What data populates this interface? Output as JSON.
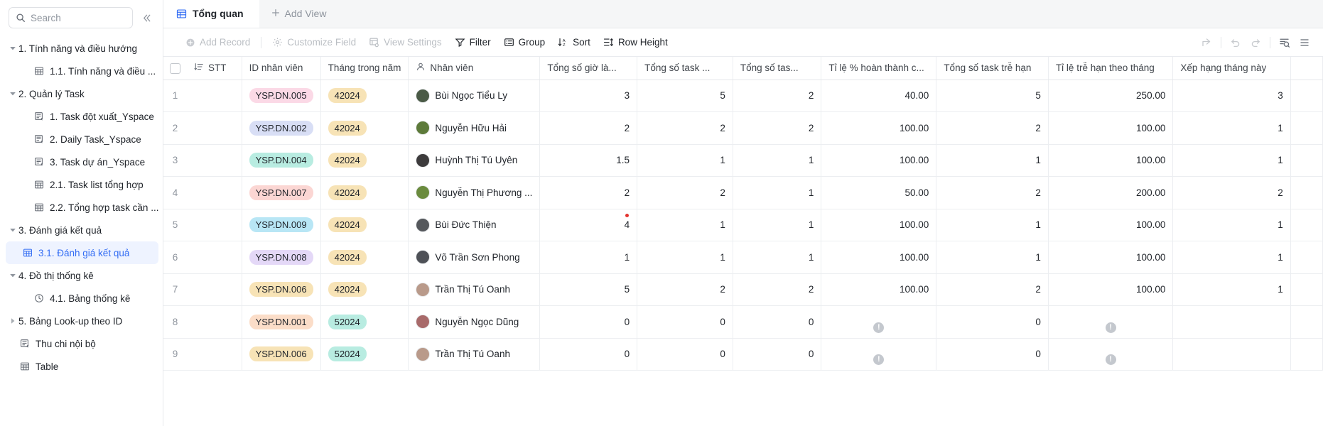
{
  "search": {
    "placeholder": "Search",
    "icon": "search-icon"
  },
  "sidebar": {
    "collapse_icon": "collapse-panel-icon",
    "items": [
      {
        "label": "1. Tính năng và điều hướng",
        "level": 0,
        "expanded": true,
        "icon": null,
        "active": false
      },
      {
        "label": "1.1. Tính năng và điều ...",
        "level": 1,
        "expanded": null,
        "icon": "table-icon",
        "active": false
      },
      {
        "label": "2. Quản lý Task",
        "level": 0,
        "expanded": true,
        "icon": null,
        "active": false
      },
      {
        "label": "1. Task đột xuất_Yspace",
        "level": 1,
        "expanded": null,
        "icon": "form-icon",
        "active": false
      },
      {
        "label": "2. Daily Task_Yspace",
        "level": 1,
        "expanded": null,
        "icon": "form-icon",
        "active": false
      },
      {
        "label": "3. Task dự án_Yspace",
        "level": 1,
        "expanded": null,
        "icon": "form-icon",
        "active": false
      },
      {
        "label": "2.1. Task list tổng hợp",
        "level": 1,
        "expanded": null,
        "icon": "table-icon",
        "active": false
      },
      {
        "label": "2.2. Tổng hợp task cần ...",
        "level": 1,
        "expanded": null,
        "icon": "table-icon",
        "active": false
      },
      {
        "label": "3. Đánh giá kết quả",
        "level": 0,
        "expanded": true,
        "icon": null,
        "active": false
      },
      {
        "label": "3.1. Đánh giá kết quả",
        "level": 1,
        "expanded": null,
        "icon": "table-icon",
        "active": true
      },
      {
        "label": "4. Đồ thị thống kê",
        "level": 0,
        "expanded": true,
        "icon": null,
        "active": false
      },
      {
        "label": "4.1. Bảng thống kê",
        "level": 1,
        "expanded": null,
        "icon": "dashboard-icon",
        "active": false
      },
      {
        "label": "5. Bảng Look-up theo ID",
        "level": 0,
        "expanded": false,
        "icon": null,
        "active": false
      },
      {
        "label": "Thu chi nội bộ",
        "level": 0,
        "expanded": null,
        "icon": "form-icon",
        "active": false
      },
      {
        "label": "Table",
        "level": 0,
        "expanded": null,
        "icon": "table-icon",
        "active": false
      }
    ]
  },
  "tabs": {
    "active": {
      "label": "Tổng quan",
      "icon": "table-icon"
    },
    "add_view": {
      "label": "Add View",
      "icon": "plus-icon"
    }
  },
  "toolbar": {
    "add_record": "Add Record",
    "customize_field": "Customize Field",
    "view_settings": "View Settings",
    "filter": "Filter",
    "group": "Group",
    "sort": "Sort",
    "row_height": "Row Height",
    "right_icons": [
      "share-icon",
      "undo-icon",
      "redo-icon",
      "search-rows-icon",
      "more-icon"
    ]
  },
  "table": {
    "columns": [
      {
        "key": "stt",
        "label": "STT",
        "icon": "sort-list-icon",
        "align": "left"
      },
      {
        "key": "id",
        "label": "ID nhân viên",
        "icon": null,
        "align": "left"
      },
      {
        "key": "month",
        "label": "Tháng trong năm",
        "icon": null,
        "align": "left"
      },
      {
        "key": "employee",
        "label": "Nhân viên",
        "icon": "person-icon",
        "align": "left"
      },
      {
        "key": "hours",
        "label": "Tổng số giờ là...",
        "icon": null,
        "align": "right"
      },
      {
        "key": "tasks",
        "label": "Tổng số task ...",
        "icon": null,
        "align": "right"
      },
      {
        "key": "tasks2",
        "label": "Tổng số tas...",
        "icon": null,
        "align": "right"
      },
      {
        "key": "pct",
        "label": "Tỉ lệ % hoàn thành c...",
        "icon": null,
        "align": "right"
      },
      {
        "key": "late",
        "label": "Tổng số task trễ hạn",
        "icon": null,
        "align": "right"
      },
      {
        "key": "late_rate",
        "label": "Tỉ lệ trễ hạn theo tháng",
        "icon": null,
        "align": "right"
      },
      {
        "key": "rank",
        "label": "Xếp hạng tháng này",
        "icon": null,
        "align": "right"
      }
    ],
    "rows": [
      {
        "n": "1",
        "stt": "",
        "id": "YSP.DN.005",
        "id_color": "#fbd9e6",
        "month": "42024",
        "month_color": "#f7e3b6",
        "employee": "Bùi Ngọc Tiểu Ly",
        "avatar_color": "#4a5a46",
        "hours": "3",
        "tasks": "5",
        "tasks2": "2",
        "pct": "40.00",
        "late": "5",
        "late_rate": "250.00",
        "rank": "3",
        "dot": false
      },
      {
        "n": "2",
        "stt": "",
        "id": "YSP.DN.002",
        "id_color": "#d8def5",
        "month": "42024",
        "month_color": "#f7e3b6",
        "employee": "Nguyễn Hữu Hải",
        "avatar_color": "#5d7a3a",
        "hours": "2",
        "tasks": "2",
        "tasks2": "2",
        "pct": "100.00",
        "late": "2",
        "late_rate": "100.00",
        "rank": "1",
        "dot": false
      },
      {
        "n": "3",
        "stt": "",
        "id": "YSP.DN.004",
        "id_color": "#b8ece1",
        "month": "42024",
        "month_color": "#f7e3b6",
        "employee": "Huỳnh Thị Tú Uyên",
        "avatar_color": "#3d3b3c",
        "hours": "1.5",
        "tasks": "1",
        "tasks2": "1",
        "pct": "100.00",
        "late": "1",
        "late_rate": "100.00",
        "rank": "1",
        "dot": false
      },
      {
        "n": "4",
        "stt": "",
        "id": "YSP.DN.007",
        "id_color": "#fbd6d3",
        "month": "42024",
        "month_color": "#f7e3b6",
        "employee": "Nguyễn Thị Phương ...",
        "avatar_color": "#6a8b3e",
        "hours": "2",
        "tasks": "2",
        "tasks2": "1",
        "pct": "50.00",
        "late": "2",
        "late_rate": "200.00",
        "rank": "2",
        "dot": false
      },
      {
        "n": "5",
        "stt": "",
        "id": "YSP.DN.009",
        "id_color": "#b8e6f5",
        "month": "42024",
        "month_color": "#f7e3b6",
        "employee": "Bùi Đức Thiện",
        "avatar_color": "#55585c",
        "hours": "4",
        "tasks": "1",
        "tasks2": "1",
        "pct": "100.00",
        "late": "1",
        "late_rate": "100.00",
        "rank": "1",
        "dot": true
      },
      {
        "n": "6",
        "stt": "",
        "id": "YSP.DN.008",
        "id_color": "#e4d8f7",
        "month": "42024",
        "month_color": "#f7e3b6",
        "employee": "Võ Trần Sơn Phong",
        "avatar_color": "#4e5157",
        "hours": "1",
        "tasks": "1",
        "tasks2": "1",
        "pct": "100.00",
        "late": "1",
        "late_rate": "100.00",
        "rank": "1",
        "dot": false
      },
      {
        "n": "7",
        "stt": "",
        "id": "YSP.DN.006",
        "id_color": "#f7e3b6",
        "month": "42024",
        "month_color": "#f7e3b6",
        "employee": "Trần Thị Tú Oanh",
        "avatar_color": "#b99a8a",
        "hours": "5",
        "tasks": "2",
        "tasks2": "2",
        "pct": "100.00",
        "late": "2",
        "late_rate": "100.00",
        "rank": "1",
        "dot": false
      },
      {
        "n": "8",
        "stt": "",
        "id": "YSP.DN.001",
        "id_color": "#fbddc8",
        "month": "52024",
        "month_color": "#b8ece1",
        "employee": "Nguyễn Ngọc Dũng",
        "avatar_color": "#a86a6a",
        "hours": "0",
        "tasks": "0",
        "tasks2": "0",
        "pct": "!",
        "late": "0",
        "late_rate": "!",
        "rank": "",
        "dot": false
      },
      {
        "n": "9",
        "stt": "",
        "id": "YSP.DN.006",
        "id_color": "#f7e3b6",
        "month": "52024",
        "month_color": "#b8ece1",
        "employee": "Trần Thị Tú Oanh",
        "avatar_color": "#b99a8a",
        "hours": "0",
        "tasks": "0",
        "tasks2": "0",
        "pct": "!",
        "late": "0",
        "late_rate": "!",
        "rank": "",
        "dot": false
      }
    ]
  },
  "colors": {
    "accent": "#336df4",
    "active_nav_bg": "#eef3ff",
    "header_bg": "#f5f6f7",
    "border": "#eceef1",
    "error_dot": "#e3342f",
    "warn_badge": "#c4c8ce"
  }
}
